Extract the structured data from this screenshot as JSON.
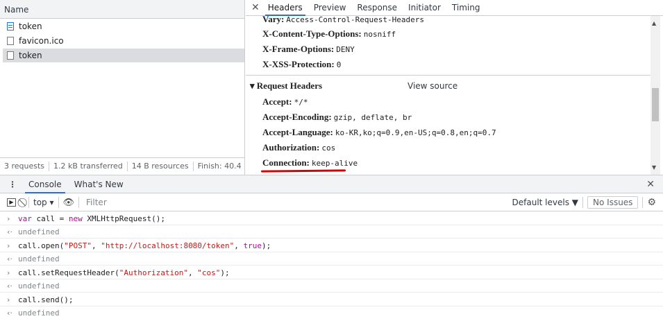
{
  "network": {
    "name_header": "Name",
    "requests": [
      {
        "name": "token",
        "icon": "document-icon"
      },
      {
        "name": "favicon.ico",
        "icon": "file-icon"
      },
      {
        "name": "token",
        "icon": "file-icon"
      }
    ],
    "status": {
      "requests": "3 requests",
      "transferred": "1.2 kB transferred",
      "resources": "14 B resources",
      "finish": "Finish: 40.4"
    }
  },
  "details": {
    "tabs": [
      "Headers",
      "Preview",
      "Response",
      "Initiator",
      "Timing"
    ],
    "response_headers": [
      {
        "name": "Vary:",
        "value": "Access-Control-Request-Headers"
      },
      {
        "name": "X-Content-Type-Options:",
        "value": "nosniff"
      },
      {
        "name": "X-Frame-Options:",
        "value": "DENY"
      },
      {
        "name": "X-XSS-Protection:",
        "value": "0"
      }
    ],
    "request_section_title": "Request Headers",
    "view_source": "View source",
    "request_headers": [
      {
        "name": "Accept:",
        "value": "*/*"
      },
      {
        "name": "Accept-Encoding:",
        "value": "gzip, deflate, br"
      },
      {
        "name": "Accept-Language:",
        "value": "ko-KR,ko;q=0.9,en-US;q=0.8,en;q=0.7"
      },
      {
        "name": "Authorization:",
        "value": "cos"
      },
      {
        "name": "Connection:",
        "value": "keep-alive"
      }
    ]
  },
  "drawer": {
    "tabs": [
      "Console",
      "What's New"
    ],
    "toolbar": {
      "context": "top",
      "filter_placeholder": "Filter",
      "levels": "Default levels ▼",
      "issues": "No Issues"
    },
    "console": {
      "l0": {
        "p1": "var",
        "p2": " call = ",
        "p3": "new",
        "p4": " XMLHttpRequest();"
      },
      "r0": "undefined",
      "l1": {
        "p1": "call.open(",
        "p2": "\"POST\"",
        "p3": ", ",
        "p4": "\"http://localhost:8080/token\"",
        "p5": ", ",
        "p6": "true",
        "p7": ");"
      },
      "r1": "undefined",
      "l2": {
        "p1": "call.setRequestHeader(",
        "p2": "\"Authorization\"",
        "p3": ", ",
        "p4": "\"cos\"",
        "p5": ");"
      },
      "r2": "undefined",
      "l3": {
        "p1": "call.send();"
      },
      "r3": "undefined"
    }
  },
  "colors": {
    "accent": "#1a73e8",
    "annotation": "#dd0000"
  }
}
